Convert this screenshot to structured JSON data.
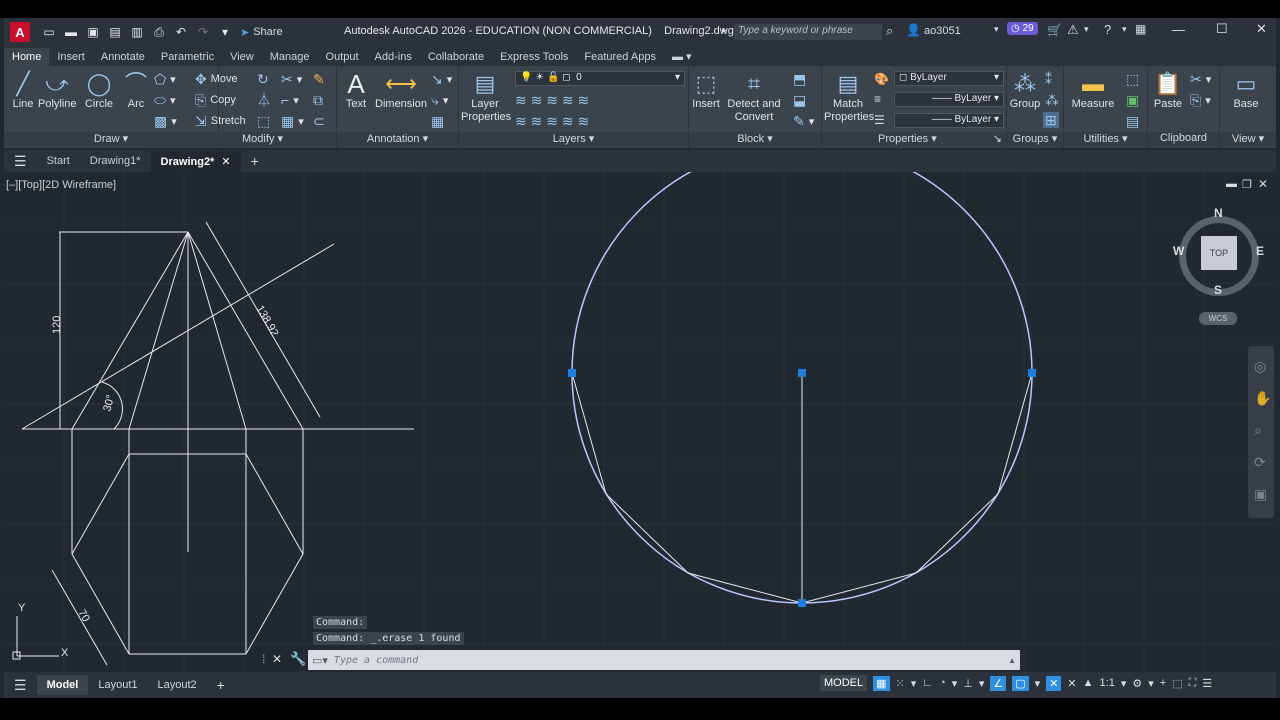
{
  "titlebar": {
    "app_title": "Autodesk AutoCAD 2026 - EDUCATION (NON COMMERCIAL)",
    "file_name": "Drawing2.dwg",
    "share_label": "Share",
    "search_placeholder": "Type a keyword or phrase",
    "username": "ao3051",
    "notifications_count": "29"
  },
  "ribbon_tabs": [
    "Home",
    "Insert",
    "Annotate",
    "Parametric",
    "View",
    "Manage",
    "Output",
    "Add-ins",
    "Collaborate",
    "Express Tools",
    "Featured Apps"
  ],
  "ribbon": {
    "draw": {
      "title": "Draw",
      "line": "Line",
      "polyline": "Polyline",
      "circle": "Circle",
      "arc": "Arc"
    },
    "modify": {
      "title": "Modify",
      "move": "Move",
      "copy": "Copy",
      "stretch": "Stretch"
    },
    "annotation": {
      "title": "Annotation",
      "text": "Text",
      "dimension": "Dimension"
    },
    "layers": {
      "title": "Layers",
      "layer_properties": "Layer Properties",
      "current_layer": "0"
    },
    "block": {
      "title": "Block",
      "insert": "Insert",
      "detect_convert": "Detect and Convert"
    },
    "properties": {
      "title": "Properties",
      "match_properties": "Match Properties",
      "color": "ByLayer",
      "linetype": "ByLayer",
      "lineweight": "ByLayer"
    },
    "groups": {
      "title": "Groups",
      "group": "Group"
    },
    "utilities": {
      "title": "Utilities",
      "measure": "Measure"
    },
    "clipboard": {
      "title": "Clipboard",
      "paste": "Paste"
    },
    "view": {
      "title": "View",
      "base": "Base"
    }
  },
  "doc_tabs": {
    "start": "Start",
    "drawing1": "Drawing1*",
    "drawing2": "Drawing2*"
  },
  "viewport": {
    "label": "[–][Top][2D Wireframe]",
    "dim_120": "120",
    "dim_138": "138.92",
    "dim_30": "30°",
    "dim_70": "70",
    "ucs_y": "Y",
    "ucs_x": "X"
  },
  "viewcube": {
    "n": "N",
    "s": "S",
    "e": "E",
    "w": "W",
    "top": "TOP",
    "wcs": "WCS"
  },
  "command": {
    "history1": "Command:",
    "history2": "Command: _.erase 1 found",
    "placeholder": "Type a command"
  },
  "statusbar": {
    "model_tab": "Model",
    "layout1": "Layout1",
    "layout2": "Layout2",
    "model_label": "MODEL",
    "scale": "1:1"
  },
  "colors": {
    "background": "#212830",
    "ribbon": "#3b434d",
    "accent": "#2f8fe0",
    "circle": "#b8c8ff",
    "grip": "#1e7fe0",
    "brand": "#c8102e"
  }
}
